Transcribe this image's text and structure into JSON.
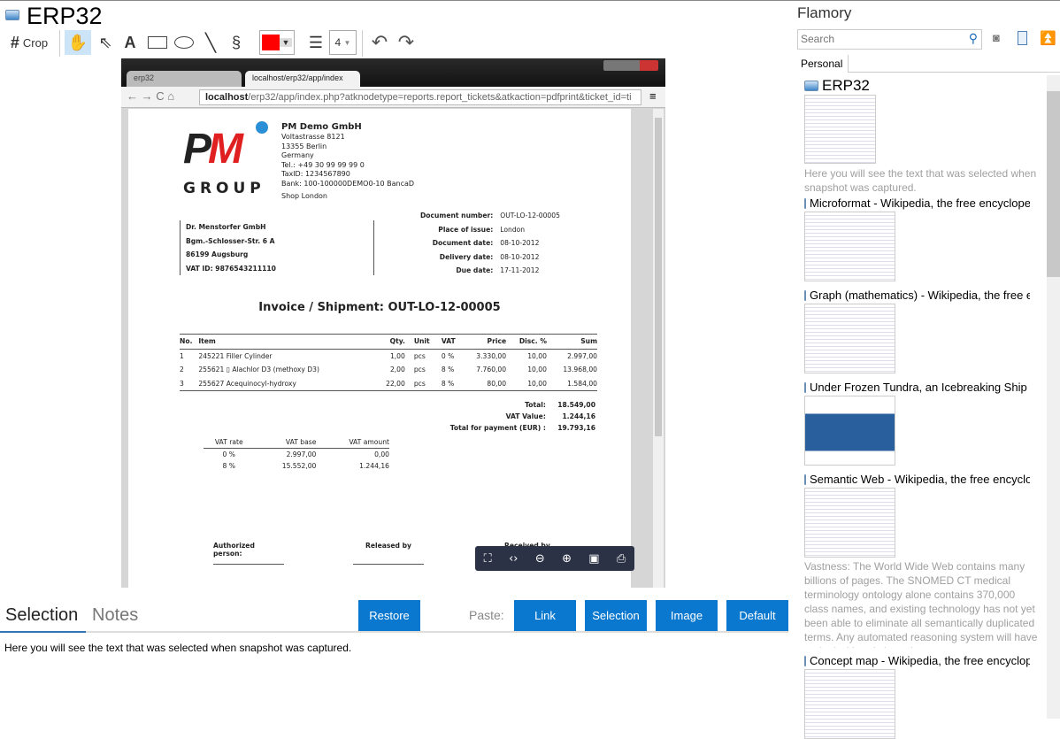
{
  "window": {
    "title": "ERP32"
  },
  "toolbar": {
    "crop_label": "Crop",
    "line_width": "4"
  },
  "browser": {
    "tab1": "erp32",
    "tab2": "localhost/erp32/app/index",
    "url_host": "localhost",
    "url_path": "/erp32/app/index.php?atknodetype=reports.report_tickets&atkaction=pdfprint&ticket_id=ti"
  },
  "invoice": {
    "logo_text": "GROUP",
    "company": {
      "name": "PM Demo GmbH",
      "lines": [
        "Voltastrasse 8121",
        "13355 Berlin",
        "Germany",
        "Tel.: +49 30 99 99 99 0",
        "TaxID: 1234567890",
        "Bank: 100-100000DEMO0-10 BancaD"
      ],
      "shop": "Shop London"
    },
    "recipient": [
      "Dr. Menstorfer GmbH",
      "Bgm.-Schlosser-Str. 6 A",
      "86199 Augsburg",
      "VAT ID: 9876543211110"
    ],
    "meta": [
      {
        "label": "Document number:",
        "value": "OUT-LO-12-00005"
      },
      {
        "label": "Place of issue:",
        "value": "London"
      },
      {
        "label": "Document date:",
        "value": "08-10-2012"
      },
      {
        "label": "Delivery date:",
        "value": "08-10-2012"
      },
      {
        "label": "Due date:",
        "value": "17-11-2012"
      }
    ],
    "heading": "Invoice / Shipment: OUT-LO-12-00005",
    "columns": [
      "No.",
      "Item",
      "Qty.",
      "Unit",
      "VAT",
      "Price",
      "Disc. %",
      "Sum"
    ],
    "rows": [
      [
        "1",
        "245221 Filler Cylinder",
        "1,00",
        "pcs",
        "0 %",
        "3.330,00",
        "10,00",
        "2.997,00"
      ],
      [
        "2",
        "255621 ▯ Alachlor D3 (methoxy D3)",
        "2,00",
        "pcs",
        "8 %",
        "7.760,00",
        "10,00",
        "13.968,00"
      ],
      [
        "3",
        "255627 Acequinocyl-hydroxy",
        "22,00",
        "pcs",
        "8 %",
        "80,00",
        "10,00",
        "1.584,00"
      ]
    ],
    "totals": [
      {
        "label": "Total:",
        "value": "18.549,00"
      },
      {
        "label": "VAT Value:",
        "value": "1.244,16"
      },
      {
        "label": "Total for payment (EUR) :",
        "value": "19.793,16"
      }
    ],
    "vat_columns": [
      "VAT rate",
      "VAT base",
      "VAT amount"
    ],
    "vat_rows": [
      [
        "0 %",
        "2.997,00",
        "0,00"
      ],
      [
        "8 %",
        "15.552,00",
        "1.244,16"
      ]
    ],
    "signatures": [
      "Authorized person:",
      "Released by",
      "Received by"
    ]
  },
  "bottom": {
    "tab_selection": "Selection",
    "tab_notes": "Notes",
    "restore": "Restore",
    "paste_label": "Paste:",
    "link": "Link",
    "selection": "Selection",
    "image": "Image",
    "default": "Default",
    "selection_text": "Here you will see the text that was selected when snapshot was captured."
  },
  "sidebar": {
    "title": "Flamory",
    "search_placeholder": "Search",
    "tab": "Personal",
    "items": [
      {
        "title": "ERP32",
        "desc": "Here you will see the text that was selected when snapshot was captured."
      },
      {
        "title": "Microformat - Wikipedia, the free encyclopedia"
      },
      {
        "title": "Graph (mathematics) - Wikipedia, the free encyclopedia"
      },
      {
        "title": "Under Frozen Tundra, an Icebreaking Ship Uncovers"
      },
      {
        "title": "Semantic Web - Wikipedia, the free encyclopedia",
        "desc": "Vastness: The World Wide Web contains many billions of pages. The SNOMED CT medical terminology ontology alone contains 370,000 class names, and existing technology has not yet been able to eliminate all semantically duplicated terms. Any automated reasoning system will have to deal with truly huge inputs."
      },
      {
        "title": "Concept map - Wikipedia, the free encyclopedia"
      }
    ]
  },
  "colors": {
    "accent": "#0a78cf",
    "pen": "#ff0000"
  }
}
